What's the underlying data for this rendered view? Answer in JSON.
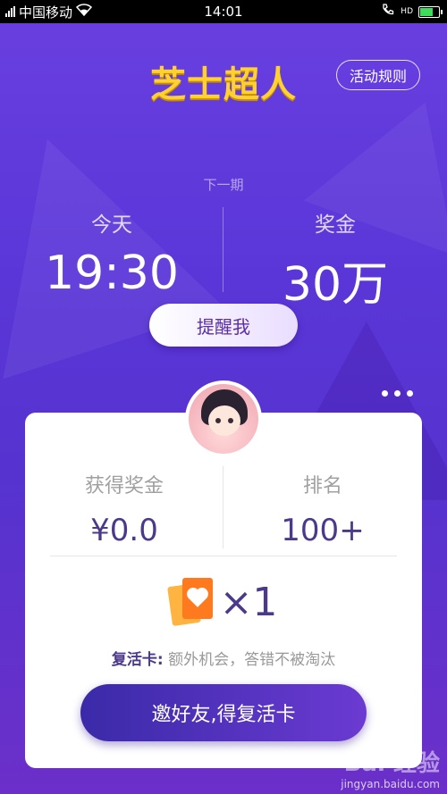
{
  "status_bar": {
    "carrier": "中国移动",
    "time": "14:01",
    "call_badge": "HD"
  },
  "header": {
    "title": "芝士超人",
    "rules_label": "活动规则"
  },
  "next_round": {
    "label": "下一期",
    "day_label": "今天",
    "time": "19:30",
    "prize_label": "奖金",
    "prize": "30万",
    "remind_label": "提醒我"
  },
  "card": {
    "earned_label": "获得奖金",
    "earned_value": "¥0.0",
    "rank_label": "排名",
    "rank_value": "100+",
    "revive_count": "×1",
    "revive_key": "复活卡:",
    "revive_desc": "额外机会，答错不被淘汰",
    "invite_label": "邀好友,得复活卡"
  },
  "icons": {
    "more": "more-dots-icon",
    "revive_card": "revive-card-icon"
  },
  "colors": {
    "title": "#ffd12e",
    "bg": "#5a36d8",
    "accent_text": "#4b3a8c",
    "revive_card": "#ff7a1f"
  },
  "watermark": {
    "brand": "Bai 经验",
    "url": "jingyan.baidu.com"
  }
}
